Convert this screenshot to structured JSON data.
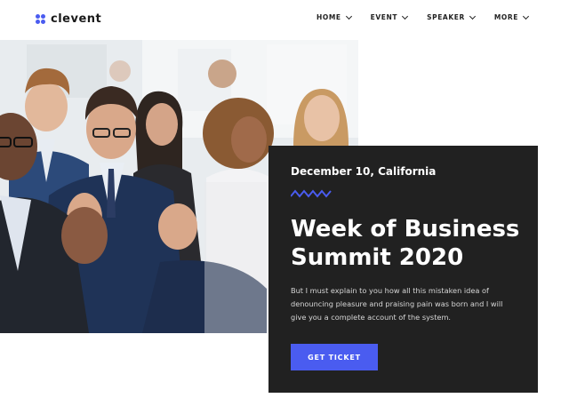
{
  "brand": {
    "name": "clevent",
    "accent_color": "#4a5cf0",
    "dark_color": "#212121"
  },
  "nav": {
    "items": [
      {
        "label": "HOME",
        "icon": "chevron-down-icon"
      },
      {
        "label": "EVENT",
        "icon": "chevron-down-icon"
      },
      {
        "label": "SPEAKER",
        "icon": "chevron-down-icon"
      },
      {
        "label": "MORE",
        "icon": "chevron-down-icon"
      }
    ]
  },
  "hero": {
    "image": "audience-applauding-photo",
    "date_location": "December 10, California",
    "divider_icon": "zigzag-icon",
    "title": "Week of Business Summit 2020",
    "description": "But I must explain to you how all this mistaken idea of denouncing pleasure and praising pain was born and I will give you a complete account of the system.",
    "cta_label": "GET TICKET"
  }
}
